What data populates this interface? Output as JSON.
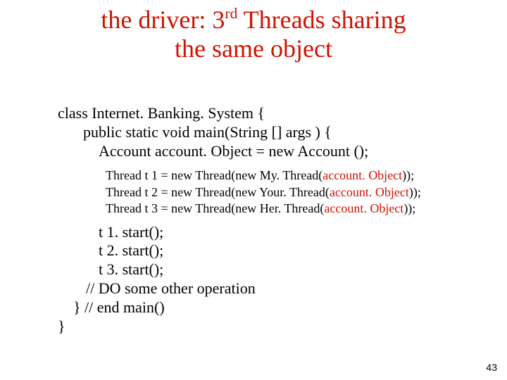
{
  "title": {
    "pre": "the driver: 3",
    "sup": "rd",
    "post": " Threads sharing",
    "line2": "the same object"
  },
  "code": {
    "line1": "class Internet. Banking. System {",
    "line2": "public static void main(String [] args  ) {",
    "line3": "Account account. Object = new Account ();",
    "thread1_a": "Thread t 1 = new Thread(new My. Thread(",
    "thread1_b": "account. Object",
    "thread1_c": "));",
    "thread2_a": "Thread t 2 = new Thread(new Your. Thread(",
    "thread2_b": "account. Object",
    "thread2_c": "));",
    "thread3_a": "Thread t 3 = new Thread(new Her. Thread(",
    "thread3_b": "account. Object",
    "thread3_c": "));",
    "start1": "t 1. start();",
    "start2": "t 2. start();",
    "start3": "t 3. start();",
    "comment": "// DO some other operation",
    "endmain": "} // end main()",
    "endclass": "}"
  },
  "page": "43",
  "colors": {
    "accent": "#d01200",
    "text": "#000000",
    "bg": "#ffffff"
  }
}
